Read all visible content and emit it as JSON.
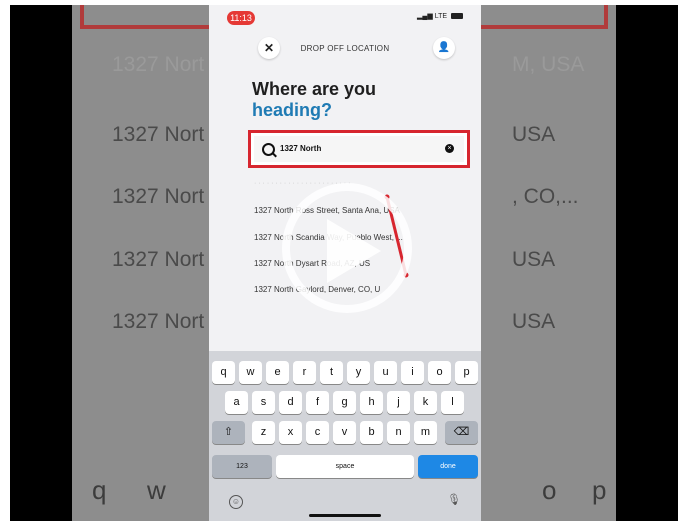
{
  "status": {
    "time": "11:13",
    "network": "LTE"
  },
  "header": {
    "title": "DROP OFF LOCATION",
    "close_icon": "close-icon",
    "person_icon": "person-icon"
  },
  "heading": {
    "line1": "Where are you",
    "line2": "heading?",
    "accent_color": "#1f7bb4"
  },
  "search": {
    "value": "1327 North",
    "highlight_color": "#d7262f"
  },
  "results": [
    {
      "text": "1327 North Ross Street, Santa Ana, USA"
    },
    {
      "text": "1327 North Scandia Way, Pueblo West, ..."
    },
    {
      "text": "1327 North Dysart Road, AZ, US"
    },
    {
      "text": "1327 North Gaylord, Denver, CO, U"
    }
  ],
  "background": {
    "rows": [
      {
        "left": "1327 Nort",
        "right": "M, USA"
      },
      {
        "left": "1327 Nort",
        "right": "USA"
      },
      {
        "left": "1327 Nort",
        "right": ", CO,..."
      },
      {
        "left": "1327 Nort",
        "right": "USA"
      },
      {
        "left": "1327 Nort",
        "right": "USA"
      }
    ],
    "keys_left": [
      "q",
      "w"
    ],
    "keys_right": [
      "o",
      "p"
    ]
  },
  "keyboard": {
    "row1": [
      "q",
      "w",
      "e",
      "r",
      "t",
      "y",
      "u",
      "i",
      "o",
      "p"
    ],
    "row2": [
      "a",
      "s",
      "d",
      "f",
      "g",
      "h",
      "j",
      "k",
      "l"
    ],
    "row3": [
      "z",
      "x",
      "c",
      "v",
      "b",
      "n",
      "m"
    ],
    "numbers_label": "123",
    "space_label": "space",
    "done_label": "done",
    "done_color": "#1e88e5"
  }
}
